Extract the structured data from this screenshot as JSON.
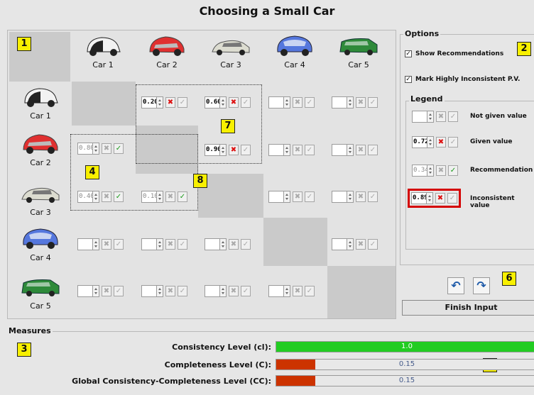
{
  "title": "Choosing a Small Car",
  "cars": [
    "Car 1",
    "Car 2",
    "Car 3",
    "Car 4",
    "Car 5"
  ],
  "car_colors": [
    "#222222",
    "#e03030",
    "#d8d8cc",
    "#4a6fd8",
    "#2e8a3a"
  ],
  "matrix": {
    "r1c2": {
      "value": "0.20",
      "kind": "given"
    },
    "r1c3": {
      "value": "0.60",
      "kind": "given"
    },
    "r1c4": {
      "value": "",
      "kind": "empty"
    },
    "r1c5": {
      "value": "",
      "kind": "empty"
    },
    "r2c1": {
      "value": "0.80",
      "kind": "rec"
    },
    "r2c3": {
      "value": "0.90",
      "kind": "given"
    },
    "r2c4": {
      "value": "",
      "kind": "empty"
    },
    "r2c5": {
      "value": "",
      "kind": "empty"
    },
    "r3c1": {
      "value": "0.40",
      "kind": "rec"
    },
    "r3c2": {
      "value": "0.10",
      "kind": "rec"
    },
    "r3c4": {
      "value": "",
      "kind": "empty"
    },
    "r3c5": {
      "value": "",
      "kind": "empty"
    },
    "r4c1": {
      "value": "",
      "kind": "empty"
    },
    "r4c2": {
      "value": "",
      "kind": "empty"
    },
    "r4c3": {
      "value": "",
      "kind": "empty"
    },
    "r4c5": {
      "value": "",
      "kind": "empty"
    },
    "r5c1": {
      "value": "",
      "kind": "empty"
    },
    "r5c2": {
      "value": "",
      "kind": "empty"
    },
    "r5c3": {
      "value": "",
      "kind": "empty"
    },
    "r5c4": {
      "value": "",
      "kind": "empty"
    }
  },
  "badges": {
    "b1": "1",
    "b2": "2",
    "b3": "3",
    "b4": "4",
    "b5": "5",
    "b6": "6",
    "b7": "7",
    "b8": "8"
  },
  "options": {
    "title": "Options",
    "show_recommendations": "Show Recommendations",
    "mark_inconsistent": "Mark Highly Inconsistent P.V."
  },
  "legend": {
    "title": "Legend",
    "not_given": "Not given value",
    "given": "Given value",
    "given_value": "0.72",
    "recommendation": "Recommendation",
    "recommendation_value": "0.34",
    "inconsistent": "Inconsistent value",
    "inconsistent_value": "0.89"
  },
  "finish_label": "Finish Input",
  "measures": {
    "title": "Measures",
    "consistency_label": "Consistency Level (cl):",
    "consistency_value": "1.0",
    "consistency_fraction": 1.0,
    "completeness_label": "Completeness Level (C):",
    "completeness_value": "0.15",
    "completeness_fraction": 0.15,
    "global_label": "Global Consistency-Completeness Level (CC):",
    "global_value": "0.15",
    "global_fraction": 0.15,
    "green": "#22cc22",
    "red": "#cc3300"
  },
  "icons": {
    "x": "✖",
    "check": "✓",
    "undo": "↶",
    "redo": "↷"
  }
}
